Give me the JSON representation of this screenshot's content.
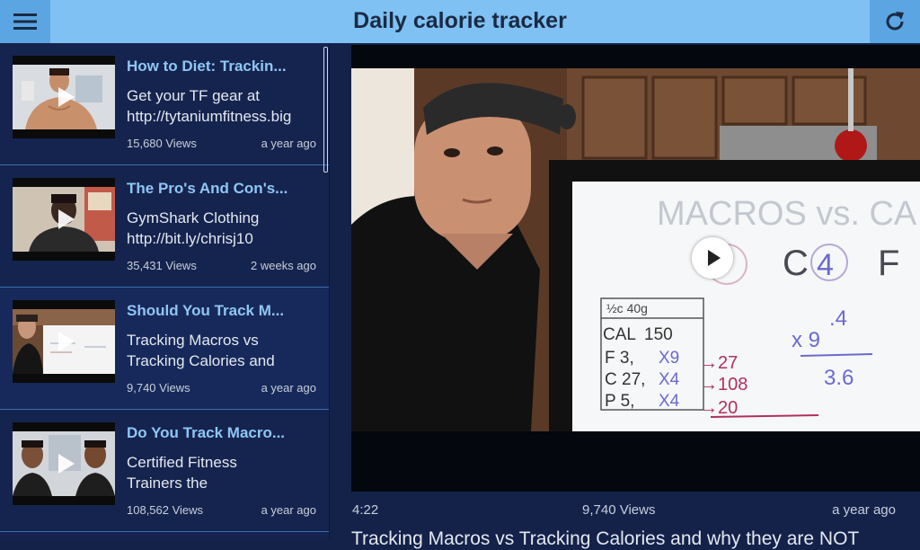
{
  "header": {
    "title": "Daily calorie tracker",
    "menu_icon": "hamburger-menu-icon",
    "refresh_icon": "refresh-icon"
  },
  "videos": [
    {
      "title": "How to Diet: Trackin...",
      "description_line1": "Get your TF gear at",
      "description_line2": "http://tytaniumfitness.big",
      "views": "15,680 Views",
      "ago": "a year ago"
    },
    {
      "title": "The Pro's And Con's...",
      "description_line1": "GymShark Clothing",
      "description_line2": "http://bit.ly/chrisj10",
      "views": "35,431 Views",
      "ago": "2 weeks ago"
    },
    {
      "title": "Should You Track M...",
      "description_line1": "Tracking Macros vs",
      "description_line2": "Tracking Calories and",
      "views": "9,740 Views",
      "ago": "a year ago"
    },
    {
      "title": "Do You Track Macro...",
      "description_line1": "Certified Fitness",
      "description_line2": "Trainers the",
      "views": "108,562 Views",
      "ago": "a year ago"
    }
  ],
  "player": {
    "duration": "4:22",
    "views": "9,740 Views",
    "ago": "a year ago",
    "title": "Tracking Macros vs Tracking Calories and why they are NOT",
    "whiteboard": {
      "heading": "MACROS vs. CA",
      "letters": [
        "C",
        "4",
        "F"
      ],
      "table_header": "½c   40g",
      "rows": [
        "CAL→150",
        "F   3, X9",
        "C  27, X4",
        "P   5, X4"
      ],
      "results": [
        "→27",
        "→108",
        "→20"
      ],
      "math": [
        ".4",
        "x  9",
        "3.6"
      ]
    }
  },
  "colors": {
    "topbar": "#7fc1f2",
    "topbar_button": "#5ba6e2",
    "background": "#14224a",
    "title_accent": "#8fc6f5"
  }
}
